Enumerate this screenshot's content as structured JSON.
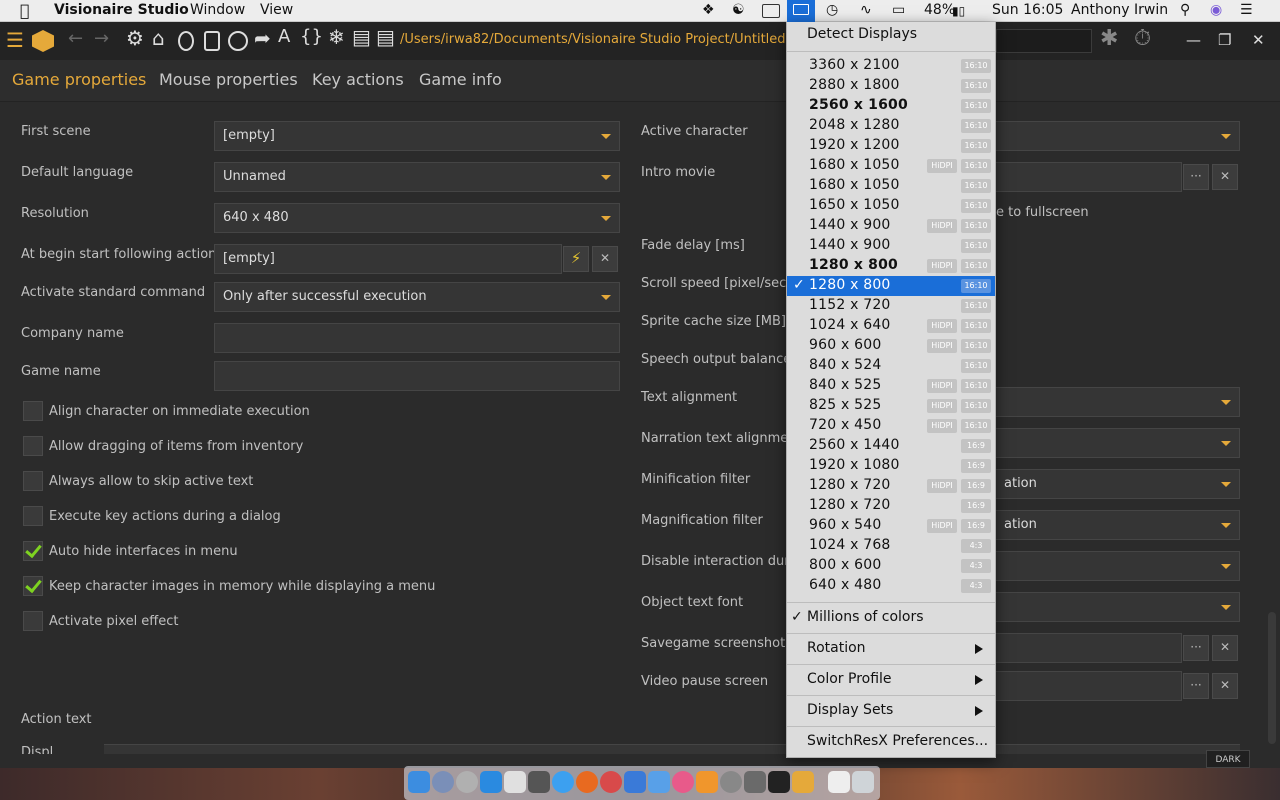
{
  "menubar": {
    "app_name": "Visionaire Studio",
    "menus": [
      "Window",
      "View"
    ],
    "battery": "48%",
    "clock": "Sun 16:05",
    "user": "Anthony Irwin"
  },
  "toolbar": {
    "path": "/Users/irwa82/Documents/Visionaire Studio Project/Untitled.ved"
  },
  "tabs": [
    "Game properties",
    "Mouse properties",
    "Key actions",
    "Game info"
  ],
  "left_form": {
    "first_scene": {
      "label": "First scene",
      "value": "[empty]"
    },
    "default_language": {
      "label": "Default language",
      "value": "Unnamed"
    },
    "resolution": {
      "label": "Resolution",
      "value": "640 x 480"
    },
    "begin_action": {
      "label": "At begin start following action",
      "value": "[empty]"
    },
    "standard_command": {
      "label": "Activate standard command",
      "value": "Only after successful execution"
    },
    "company_name": {
      "label": "Company name",
      "value": ""
    },
    "game_name": {
      "label": "Game name",
      "value": ""
    },
    "checkboxes": [
      {
        "label": "Align character on immediate execution",
        "checked": false
      },
      {
        "label": "Allow dragging of items from inventory",
        "checked": false
      },
      {
        "label": "Always allow to skip active text",
        "checked": false
      },
      {
        "label": "Execute key actions during a dialog",
        "checked": false
      },
      {
        "label": "Auto hide interfaces in menu",
        "checked": true
      },
      {
        "label": "Keep character images in memory while displaying a menu",
        "checked": true
      },
      {
        "label": "Activate pixel effect",
        "checked": false
      }
    ],
    "action_text": "Action text",
    "display_partial": "Displ"
  },
  "right_form": {
    "labels": {
      "active_character": "Active character",
      "intro_movie": "Intro movie",
      "fade_delay": "Fade delay [ms]",
      "scroll_speed": "Scroll speed [pixel/sec]",
      "sprite_cache": "Sprite cache size [MB]",
      "speech_balance": "Speech output balance [%",
      "text_alignment": "Text alignment",
      "narration_alignment": "Narration text alignment",
      "minification": "Minification filter",
      "magnification": "Magnification filter",
      "disable_interaction": "Disable interaction during",
      "object_font": "Object text font",
      "savegame_screenshot": "Savegame screenshot",
      "video_pause": "Video pause screen"
    },
    "fullscreen_partial": "e to fullscreen",
    "min_partial": "ation",
    "mag_partial": "ation"
  },
  "display_menu": {
    "detect": "Detect Displays",
    "resolutions": [
      {
        "res": "3360 x 2100",
        "hidpi": "",
        "aspect": "16:10",
        "bold": false,
        "selected": false
      },
      {
        "res": "2880 x 1800",
        "hidpi": "",
        "aspect": "16:10",
        "bold": false,
        "selected": false
      },
      {
        "res": "2560 x 1600",
        "hidpi": "",
        "aspect": "16:10",
        "bold": true,
        "selected": false
      },
      {
        "res": "2048 x 1280",
        "hidpi": "",
        "aspect": "16:10",
        "bold": false,
        "selected": false
      },
      {
        "res": "1920 x 1200",
        "hidpi": "",
        "aspect": "16:10",
        "bold": false,
        "selected": false
      },
      {
        "res": "1680 x 1050",
        "hidpi": "HiDPI",
        "aspect": "16:10",
        "bold": false,
        "selected": false
      },
      {
        "res": "1680 x 1050",
        "hidpi": "",
        "aspect": "16:10",
        "bold": false,
        "selected": false
      },
      {
        "res": "1650 x 1050",
        "hidpi": "",
        "aspect": "16:10",
        "bold": false,
        "selected": false
      },
      {
        "res": "1440 x 900",
        "hidpi": "HiDPI",
        "aspect": "16:10",
        "bold": false,
        "selected": false
      },
      {
        "res": "1440 x 900",
        "hidpi": "",
        "aspect": "16:10",
        "bold": false,
        "selected": false
      },
      {
        "res": "1280 x 800",
        "hidpi": "HiDPI",
        "aspect": "16:10",
        "bold": true,
        "selected": false
      },
      {
        "res": "1280 x 800",
        "hidpi": "",
        "aspect": "16:10",
        "bold": false,
        "selected": true
      },
      {
        "res": "1152 x 720",
        "hidpi": "",
        "aspect": "16:10",
        "bold": false,
        "selected": false
      },
      {
        "res": "1024 x 640",
        "hidpi": "HiDPI",
        "aspect": "16:10",
        "bold": false,
        "selected": false
      },
      {
        "res": "960 x 600",
        "hidpi": "HiDPI",
        "aspect": "16:10",
        "bold": false,
        "selected": false
      },
      {
        "res": "840 x 524",
        "hidpi": "",
        "aspect": "16:10",
        "bold": false,
        "selected": false
      },
      {
        "res": "840 x 525",
        "hidpi": "HiDPI",
        "aspect": "16:10",
        "bold": false,
        "selected": false
      },
      {
        "res": "825 x 525",
        "hidpi": "HiDPI",
        "aspect": "16:10",
        "bold": false,
        "selected": false
      },
      {
        "res": "720 x 450",
        "hidpi": "HiDPI",
        "aspect": "16:10",
        "bold": false,
        "selected": false
      },
      {
        "res": "2560 x 1440",
        "hidpi": "",
        "aspect": "16:9",
        "bold": false,
        "selected": false
      },
      {
        "res": "1920 x 1080",
        "hidpi": "",
        "aspect": "16:9",
        "bold": false,
        "selected": false
      },
      {
        "res": "1280 x 720",
        "hidpi": "HiDPI",
        "aspect": "16:9",
        "bold": false,
        "selected": false
      },
      {
        "res": "1280 x 720",
        "hidpi": "",
        "aspect": "16:9",
        "bold": false,
        "selected": false
      },
      {
        "res": "960 x 540",
        "hidpi": "HiDPI",
        "aspect": "16:9",
        "bold": false,
        "selected": false
      },
      {
        "res": "1024 x 768",
        "hidpi": "",
        "aspect": "4:3",
        "bold": false,
        "selected": false
      },
      {
        "res": "800 x 600",
        "hidpi": "",
        "aspect": "4:3",
        "bold": false,
        "selected": false
      },
      {
        "res": "640 x 480",
        "hidpi": "",
        "aspect": "4:3",
        "bold": false,
        "selected": false
      }
    ],
    "colors": "Millions of colors",
    "rotation": "Rotation",
    "color_profile": "Color Profile",
    "display_sets": "Display Sets",
    "preferences": "SwitchResX Preferences..."
  },
  "dark_label": "DARK",
  "colors": {
    "accent": "#e5a93a",
    "selection": "#1a6ed8",
    "check": "#7ed321"
  }
}
